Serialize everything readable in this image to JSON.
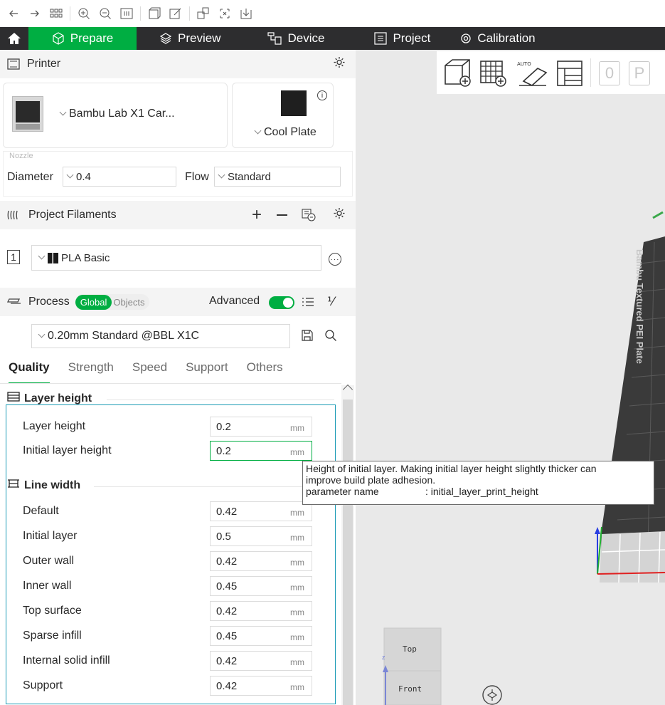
{
  "toolbar": {
    "icons": [
      "arrow-left-icon",
      "arrow-right-icon",
      "grid-icon",
      "zoom-in-icon",
      "zoom-out-icon",
      "fit-view-icon",
      "object-icon",
      "edit-icon",
      "arrange-icon",
      "orient-icon",
      "download-icon"
    ]
  },
  "nav": {
    "tabs": [
      {
        "label": "Prepare",
        "icon": "cube-icon"
      },
      {
        "label": "Preview",
        "icon": "layers-icon"
      },
      {
        "label": "Device",
        "icon": "device-icon"
      },
      {
        "label": "Project",
        "icon": "list-icon"
      },
      {
        "label": "Calibration",
        "icon": "calibration-icon"
      }
    ]
  },
  "printer": {
    "title": "Printer",
    "name": "Bambu Lab X1 Car...",
    "plate": "Cool Plate",
    "nozzle_label": "Nozzle",
    "diameter_label": "Diameter",
    "diameter_value": "0.4",
    "flow_label": "Flow",
    "flow_value": "Standard"
  },
  "filaments": {
    "title": "Project Filaments",
    "items": [
      {
        "index": "1",
        "name": "PLA Basic"
      }
    ]
  },
  "process": {
    "title": "Process",
    "scope_on": "Global",
    "scope_off": "Objects",
    "advanced_label": "Advanced",
    "preset": "0.20mm Standard @BBL X1C",
    "tabs": [
      "Quality",
      "Strength",
      "Speed",
      "Support",
      "Others"
    ],
    "active_tab": "Quality"
  },
  "quality": {
    "layer_height_title": "Layer height",
    "layer_height_rows": [
      {
        "label": "Layer height",
        "value": "0.2",
        "unit": "mm"
      },
      {
        "label": "Initial layer height",
        "value": "0.2",
        "unit": "mm"
      }
    ],
    "line_width_title": "Line width",
    "line_width_rows": [
      {
        "label": "Default",
        "value": "0.42",
        "unit": "mm"
      },
      {
        "label": "Initial layer",
        "value": "0.5",
        "unit": "mm"
      },
      {
        "label": "Outer wall",
        "value": "0.42",
        "unit": "mm"
      },
      {
        "label": "Inner wall",
        "value": "0.45",
        "unit": "mm"
      },
      {
        "label": "Top surface",
        "value": "0.42",
        "unit": "mm"
      },
      {
        "label": "Sparse infill",
        "value": "0.45",
        "unit": "mm"
      },
      {
        "label": "Internal solid infill",
        "value": "0.42",
        "unit": "mm"
      },
      {
        "label": "Support",
        "value": "0.42",
        "unit": "mm"
      }
    ]
  },
  "tooltip": {
    "line1": "Height of initial layer. Making initial layer height slightly thicker can",
    "line2": "improve build plate adhesion.",
    "param_label": "parameter name",
    "param_value": ": initial_layer_print_height"
  },
  "viewport": {
    "plate_text": "Bambu Textured PEI Plate",
    "cube_top": "Top",
    "cube_front": "Front",
    "axis_z": "z",
    "toolbar_labels": [
      "0",
      "P"
    ]
  },
  "colors": {
    "accent": "#00ae42",
    "nav_bg": "#2d2d2f",
    "viewport_bg": "#e9e9e9",
    "plate": "#3a3a3a"
  }
}
